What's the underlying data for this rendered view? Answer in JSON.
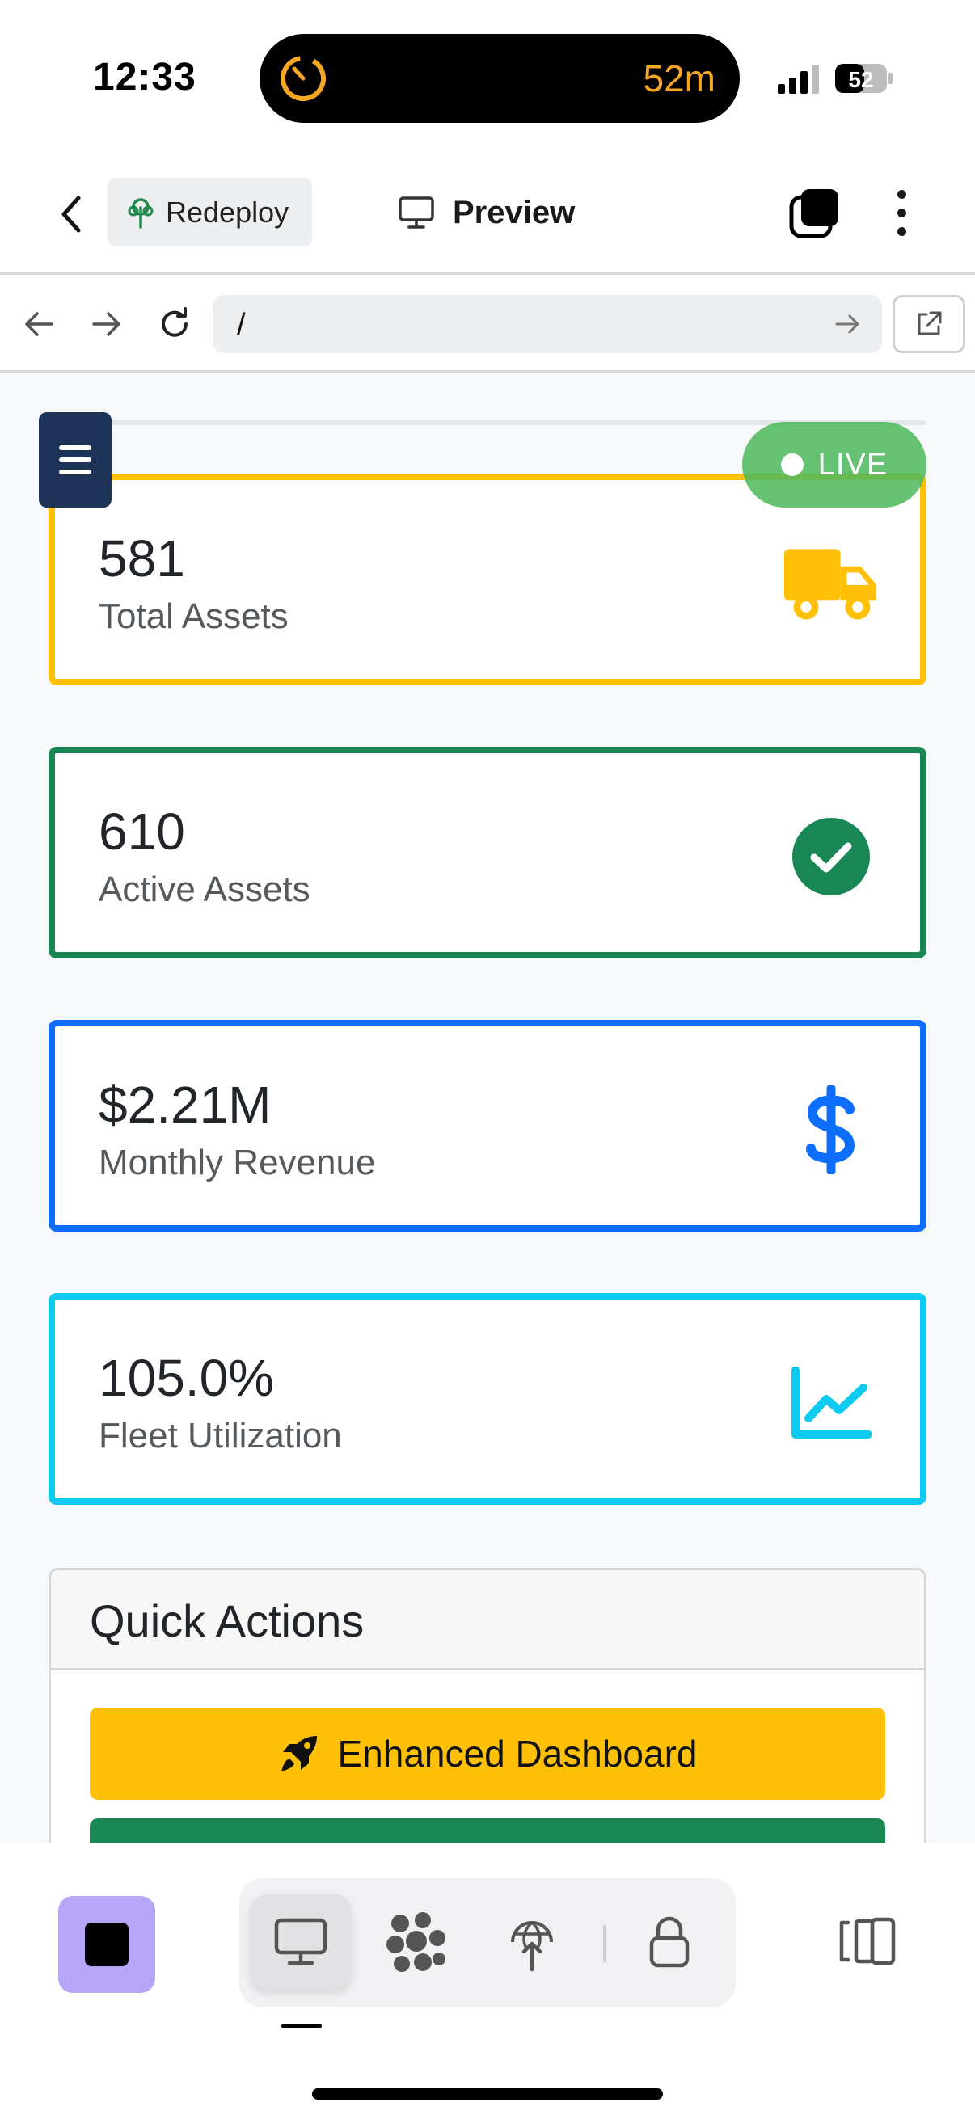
{
  "status_bar": {
    "time": "12:33",
    "island_timer": "52m",
    "battery": "52",
    "icons": [
      "timer-ring-icon",
      "cellular-signal-icon",
      "battery-icon"
    ]
  },
  "header": {
    "back_icon": "chevron-left-icon",
    "redeploy_label": "Redeploy",
    "redeploy_icon": "tree-icon",
    "preview_label": "Preview",
    "preview_icon": "monitor-icon",
    "tabs_icon": "tabs-stack-icon",
    "more_icon": "more-vertical-icon"
  },
  "url_bar": {
    "path": "/",
    "icons": [
      "arrow-left-icon",
      "arrow-right-icon",
      "reload-icon",
      "go-arrow-icon",
      "external-link-icon"
    ]
  },
  "page": {
    "live_label": "LIVE",
    "menu_icon": "hamburger-menu-icon",
    "stats": [
      {
        "value": "581",
        "label": "Total Assets",
        "color": "#ffc107",
        "icon": "truck-icon"
      },
      {
        "value": "610",
        "label": "Active Assets",
        "color": "#198754",
        "icon": "check-circle-icon"
      },
      {
        "value": "$2.21M",
        "label": "Monthly Revenue",
        "color": "#0d6efd",
        "icon": "dollar-icon"
      },
      {
        "value": "105.0%",
        "label": "Fleet Utilization",
        "color": "#0dcaf0",
        "icon": "chart-line-icon"
      }
    ],
    "quick_actions": {
      "title": "Quick Actions",
      "buttons": [
        {
          "label": "Enhanced Dashboard",
          "color": "#ffc107",
          "icon": "rocket-icon"
        },
        {
          "label": "",
          "color": "#198754"
        }
      ]
    }
  },
  "bottom_bar": {
    "stop_icon": "stop-icon",
    "tools": [
      "monitor-icon",
      "flower-cluster-icon",
      "globe-upload-icon",
      "lock-icon"
    ],
    "layout_icon": "panel-layout-icon"
  }
}
